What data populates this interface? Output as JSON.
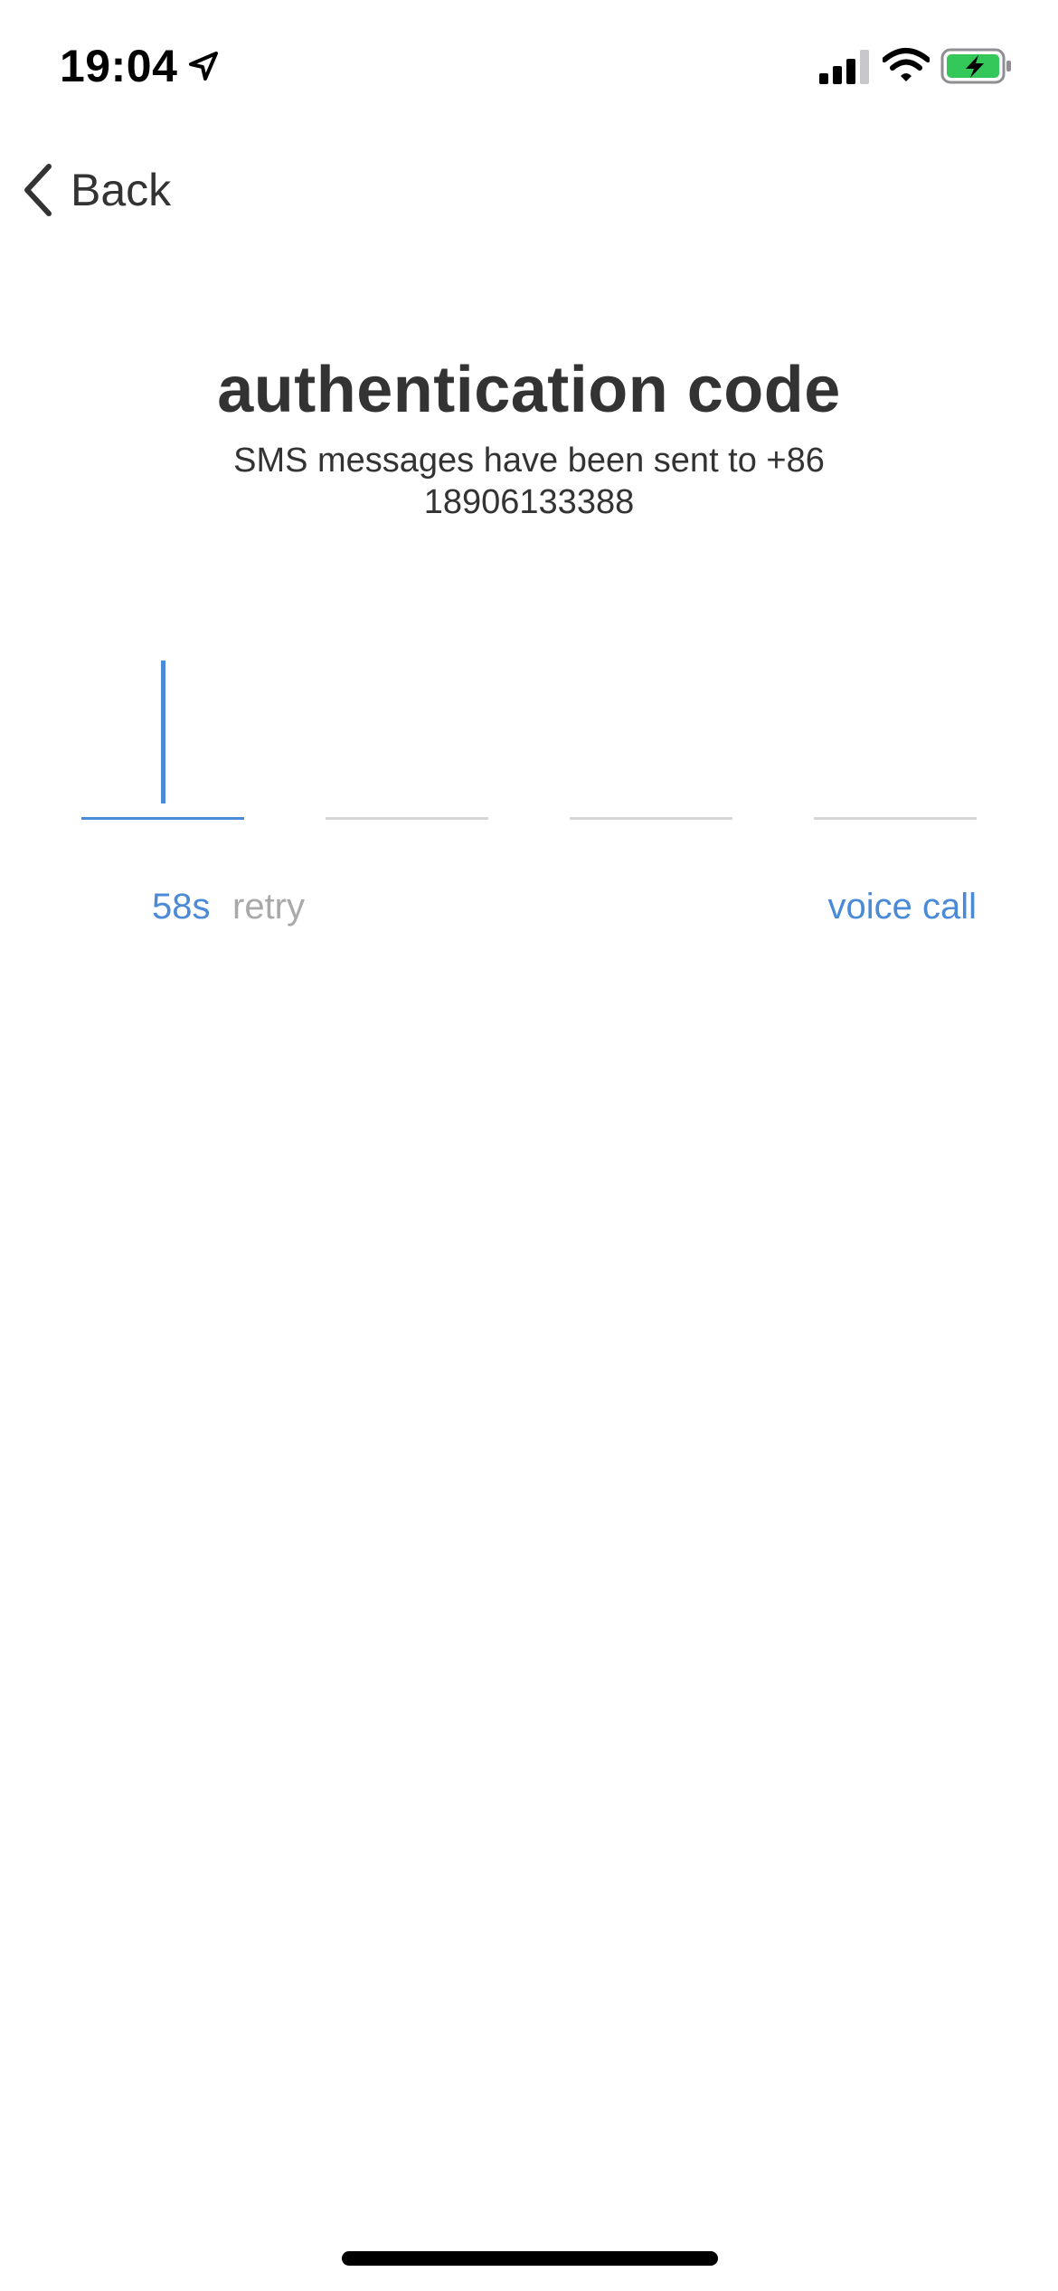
{
  "status_bar": {
    "time": "19:04",
    "location_icon": "location-arrow-icon",
    "signal_icon": "cellular-signal-icon",
    "wifi_icon": "wifi-icon",
    "battery_icon": "battery-charging-icon",
    "battery_color": "#34c759"
  },
  "nav": {
    "back_label": "Back",
    "back_icon": "chevron-left-icon"
  },
  "header": {
    "title": "authentication code",
    "subtitle": "SMS messages have been sent to +86 18906133388"
  },
  "code_input": {
    "digits": [
      "",
      "",
      "",
      ""
    ],
    "active_index": 0,
    "active_color": "#4a8ad6",
    "inactive_color": "#d6d6d6"
  },
  "actions": {
    "countdown": "58s",
    "retry_label": "retry",
    "voice_call_label": "voice call",
    "link_color": "#4a8ad6",
    "disabled_color": "#a9a9a9"
  }
}
